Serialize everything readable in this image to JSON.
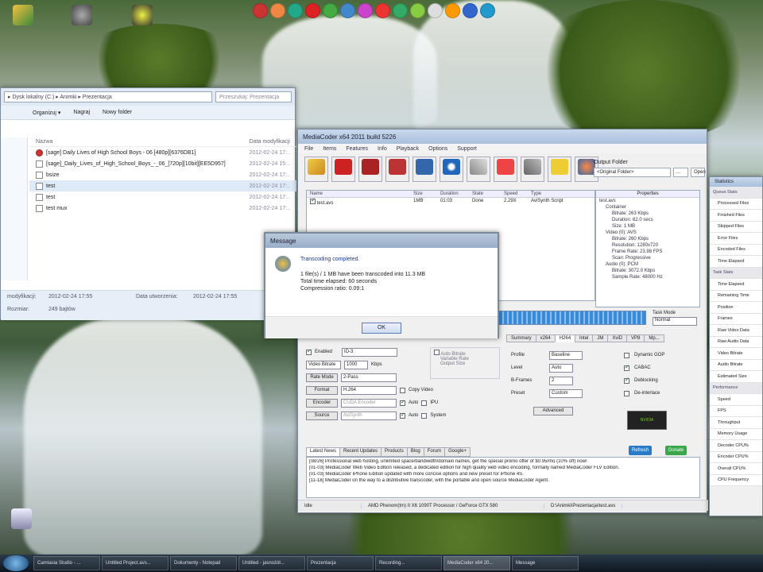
{
  "desktop": {
    "icons": [
      "Computer",
      "Kosz",
      "Untitled"
    ]
  },
  "explorer": {
    "address": "▸ Dysk lokalny (C:) ▸ Animki ▸ Prezentacja",
    "search_placeholder": "Przeszukaj: Prezentacja",
    "toolbar": [
      "Organizuj ▾",
      "Nagraj",
      "Nowy folder"
    ],
    "col_name": "Nazwa",
    "col_date": "Data modyfikacji",
    "files": [
      {
        "name": "[sage] Daily Lives of High School Boys - 06 [480p][6376DB1]",
        "date": "2012-02-24 17:..",
        "icon": "red"
      },
      {
        "name": "[sage]_Daily_Lives_of_High_School_Boys_-_06_[720p][10bit][EE5D957]",
        "date": "2012-02-24 15:..",
        "icon": "file"
      },
      {
        "name": "bsize",
        "date": "2012-02-24 17:..",
        "icon": "file"
      },
      {
        "name": "test",
        "date": "2012-02-24 17:..",
        "icon": "file"
      },
      {
        "name": "test",
        "date": "2012-02-24 17:..",
        "icon": "file"
      },
      {
        "name": "test mux",
        "date": "2012-02-24 17:..",
        "icon": "file"
      }
    ],
    "details": {
      "modified_label": "modyfikacji:",
      "modified_value": "2012-02-24 17:55",
      "created_label": "Data utworzenia:",
      "created_value": "2012-02-24 17:55",
      "size_label": "Rozmiar:",
      "size_value": "249 bajtów"
    }
  },
  "mediacoder": {
    "title": "MediaCoder x64 2011 build 5226",
    "menu": [
      "File",
      "Items",
      "Features",
      "Info",
      "Playback",
      "Options",
      "Support"
    ],
    "tools": [
      "Add",
      "",
      "",
      "",
      "",
      "",
      "",
      "",
      "",
      ""
    ],
    "output_folder_label": "Output Folder",
    "output_folder_value": "<Original Folder>",
    "open_label": "Open",
    "list_headers": [
      "Name",
      "Size",
      "Duration",
      "State",
      "Speed",
      "Type"
    ],
    "list_rows": [
      {
        "name": "test.avs",
        "size": "1MB",
        "duration": "01:03",
        "state": "Done",
        "speed": "2.29X",
        "type": "AviSynth Script"
      }
    ],
    "properties_title": "Properties",
    "properties": [
      "test.avs",
      "Container",
      "Bitrate: 263 Kbps",
      "Duration: 62.0 secs",
      "Size: 1 MB",
      "Video (0): AVS",
      "Bitrate: 260 Kbps",
      "Resolution: 1280x720",
      "Frame Rate: 23.98 FPS",
      "Scan: Progressive",
      "Audio (0): PCM",
      "Bitrate: 3072.0 Kbps",
      "Sample Rate: 48000 Hz"
    ],
    "task_mode_label": "Task Mode",
    "task_mode_value": "Normal",
    "tabs": [
      "Summary",
      "x264",
      "H264",
      "Intel",
      "JM",
      "XviD",
      "VP8",
      "Mp..."
    ],
    "active_tab": "H264",
    "left": {
      "enabled": "Enabled",
      "codec": "ID-3",
      "mode": "Video Bitrate",
      "bitrate": "1000",
      "kbps": "Kbps",
      "rate_mode_btn": "Rate Mode",
      "rate_mode_val": "2-Pass",
      "format_btn": "Format",
      "format_val": "H.264",
      "encoder_btn": "Encoder",
      "encoder_val": "CUDA Encoder",
      "source_btn": "Source",
      "source_val": "AviSynth",
      "auto_bitrate": "Auto Bitrate",
      "avail_options": [
        "Variable Rate",
        "Output Size"
      ],
      "copy_video": "Copy Video",
      "auto1": "Auto",
      "ipu": "IPU",
      "auto2": "Auto",
      "system": "System"
    },
    "right": {
      "profile_label": "Profile",
      "profile_val": "Baseline",
      "level_label": "Level",
      "level_val": "Auto",
      "bframes_label": "B-Frames",
      "bframes_val": "2",
      "preset_label": "Preset",
      "preset_val": "Custom",
      "dynamic_gop": "Dynamic GOP",
      "cabac": "CABAC",
      "deblocking": "Deblocking",
      "deinterlace": "De-interlace",
      "advanced_btn": "Advanced",
      "nvidia": "NVIDIA"
    },
    "news_tabs": [
      "Latest News",
      "Recent Updates",
      "Products",
      "Blog",
      "Forum",
      "Google+"
    ],
    "refresh": "Refresh",
    "donate": "Donate",
    "news": [
      "[08/26] Professional web hosting, unlimited space/bandwidth/domain names, get the special promo offer of $0.95/mo (10% off) now!",
      "[01-03] MediaCoder Web Video Edition released, a dedicated edition for high quality web video encoding, formally named MediaCoder FLV Edition.",
      "[01-03] MediaCoder iPhone Edition updated with more concise options and new preset for iPhone 4S.",
      "[11-18] MediaCoder on the way to a distributive transcoder, with the portable and open source MediaCoder Agent."
    ],
    "status": [
      "Idle",
      "AMD Phenom(tm) II X6 1090T Processor / GeForce GTX 580",
      "D:\\Animki\\Prezentacja\\test.avs"
    ]
  },
  "message": {
    "title": "Message",
    "heading": "Transcoding completed.",
    "line1": "1 file(s) / 1 MB have been transcoded into 11.3 MB",
    "line2": "Total time elapsed: 60 seconds",
    "line3": "Compression ratio: 0.09:1",
    "ok": "OK"
  },
  "stats": {
    "title": "Statistics",
    "items": [
      {
        "g": true,
        "t": "Queue Stats"
      },
      {
        "t": "Processed Files"
      },
      {
        "t": "Finished Files"
      },
      {
        "t": "Skipped Files"
      },
      {
        "t": "Error Files"
      },
      {
        "t": "Encoded Files"
      },
      {
        "t": "Time Elapsed"
      },
      {
        "g": true,
        "t": "Task Stats"
      },
      {
        "t": "Time Elapsed"
      },
      {
        "t": "Remaining Time"
      },
      {
        "t": "Position"
      },
      {
        "t": "Frames"
      },
      {
        "t": "Raw Video Data"
      },
      {
        "t": "Raw Audio Data"
      },
      {
        "t": "Video Bitrate"
      },
      {
        "t": "Audio Bitrate"
      },
      {
        "t": "Estimated Size"
      },
      {
        "g": true,
        "t": "Performance"
      },
      {
        "t": "Speed"
      },
      {
        "t": "FPS"
      },
      {
        "t": "Throughput"
      },
      {
        "t": "Memory Usage"
      },
      {
        "t": "Decoder CPU%"
      },
      {
        "t": "Encoder CPU%"
      },
      {
        "t": "Overall CPU%"
      },
      {
        "t": "CPU Frequency"
      }
    ]
  },
  "taskbar": [
    {
      "label": "Camtasia Studio - ...",
      "active": false
    },
    {
      "label": "Untitled Project.avs...",
      "active": false
    },
    {
      "label": "Dokumenty - Notepad",
      "active": false
    },
    {
      "label": "Untitled - jasnożół...",
      "active": false
    },
    {
      "label": "Prezentacja",
      "active": false
    },
    {
      "label": "Recording...",
      "active": false
    },
    {
      "label": "MediaCoder x64 20...",
      "active": true
    },
    {
      "label": "Message",
      "active": false
    }
  ]
}
